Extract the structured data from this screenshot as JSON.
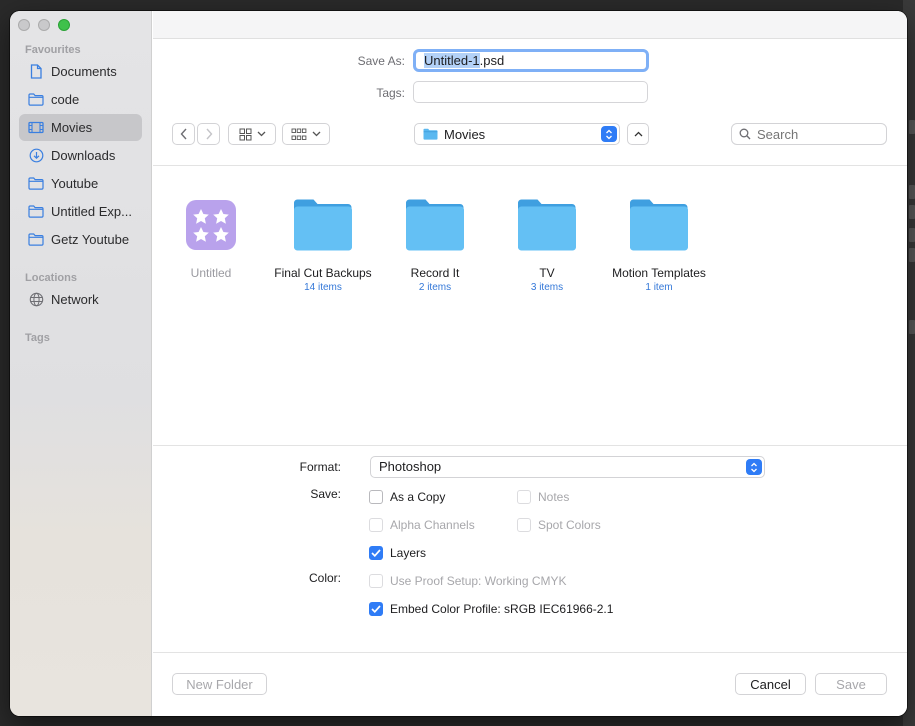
{
  "sidebar": {
    "favourites_heading": "Favourites",
    "locations_heading": "Locations",
    "tags_heading": "Tags",
    "favourites": [
      {
        "label": "Documents",
        "icon": "document-icon"
      },
      {
        "label": "code",
        "icon": "folder-icon"
      },
      {
        "label": "Movies",
        "icon": "film-icon",
        "selected": true
      },
      {
        "label": "Downloads",
        "icon": "download-icon"
      },
      {
        "label": "Youtube",
        "icon": "folder-icon"
      },
      {
        "label": "Untitled Exp...",
        "icon": "folder-icon"
      },
      {
        "label": "Getz Youtube",
        "icon": "folder-icon"
      }
    ],
    "locations": [
      {
        "label": "Network",
        "icon": "globe-icon"
      }
    ]
  },
  "save_as": {
    "label": "Save As:",
    "selected_text": "Untitled-1",
    "extension": ".psd"
  },
  "tags": {
    "label": "Tags:",
    "value": ""
  },
  "toolbar": {
    "location": "Movies",
    "search_placeholder": "Search"
  },
  "files": [
    {
      "name": "Untitled",
      "count": "",
      "type": "app",
      "dim": true
    },
    {
      "name": "Final Cut Backups",
      "count": "14 items",
      "type": "folder"
    },
    {
      "name": "Record It",
      "count": "2 items",
      "type": "folder"
    },
    {
      "name": "TV",
      "count": "3 items",
      "type": "folder"
    },
    {
      "name": "Motion Templates",
      "count": "1 item",
      "type": "folder"
    }
  ],
  "options": {
    "format_label": "Format:",
    "format_value": "Photoshop",
    "save_label": "Save:",
    "color_label": "Color:",
    "as_a_copy": {
      "label": "As a Copy",
      "checked": false,
      "enabled": true
    },
    "notes": {
      "label": "Notes",
      "checked": false,
      "enabled": false
    },
    "alpha_channels": {
      "label": "Alpha Channels",
      "checked": false,
      "enabled": false
    },
    "spot_colors": {
      "label": "Spot Colors",
      "checked": false,
      "enabled": false
    },
    "layers": {
      "label": "Layers",
      "checked": true,
      "enabled": true
    },
    "use_proof_setup": {
      "label": "Use Proof Setup:  Working CMYK",
      "checked": false,
      "enabled": false
    },
    "embed_color_profile": {
      "label": "Embed Color Profile:  sRGB IEC61966-2.1",
      "checked": true,
      "enabled": true
    }
  },
  "buttons": {
    "new_folder": "New Folder",
    "cancel": "Cancel",
    "save": "Save"
  },
  "colors": {
    "accent": "#2f7cf6",
    "folder": "#5ab8f0",
    "selection": "#b3d1f7"
  }
}
